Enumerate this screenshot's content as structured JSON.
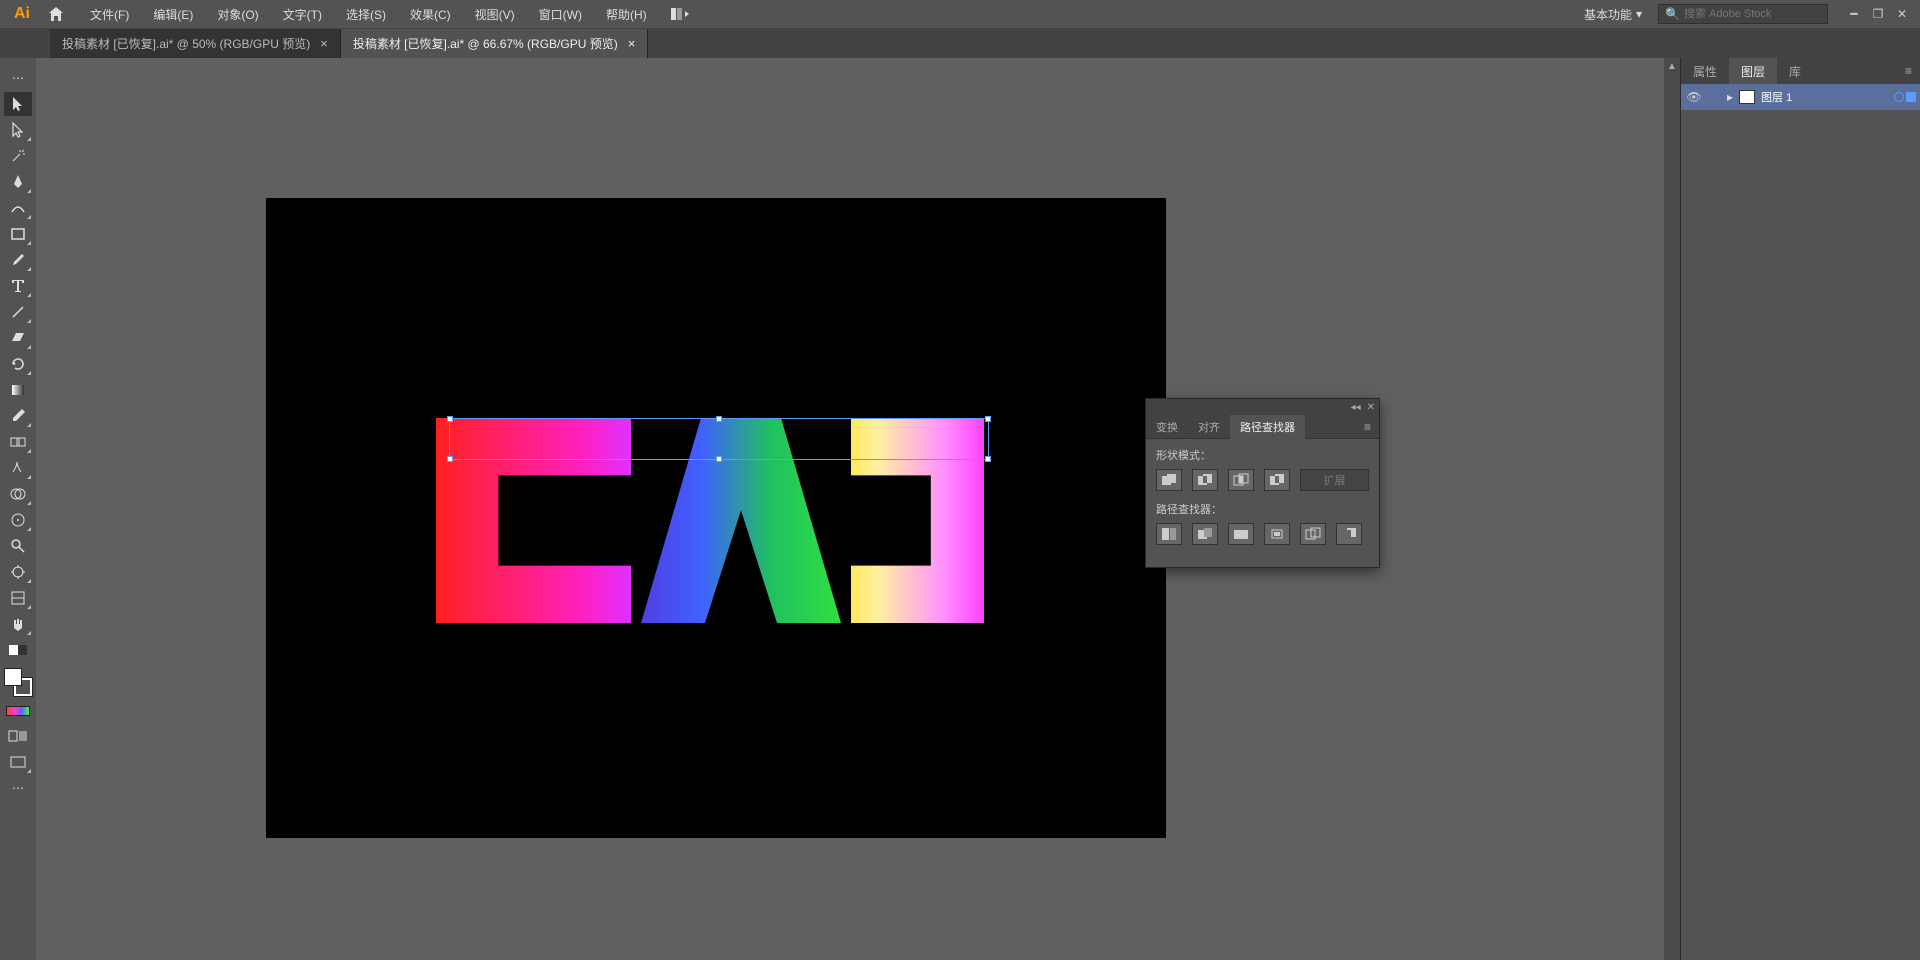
{
  "menubar": {
    "items": [
      "文件(F)",
      "编辑(E)",
      "对象(O)",
      "文字(T)",
      "选择(S)",
      "效果(C)",
      "视图(V)",
      "窗口(W)",
      "帮助(H)"
    ],
    "workspace": "基本功能",
    "search_placeholder": "搜索 Adobe Stock"
  },
  "tabs": [
    {
      "label": "投稿素材 [已恢复].ai* @ 50% (RGB/GPU 预览)",
      "active": false
    },
    {
      "label": "投稿素材 [已恢复].ai* @ 66.67% (RGB/GPU 预览)",
      "active": true
    }
  ],
  "right_panel": {
    "tabs": [
      "属性",
      "图层",
      "库"
    ],
    "active_tab": 1,
    "layer_name": "图层 1"
  },
  "pathfinder": {
    "tabs": [
      "变换",
      "对齐",
      "路径查找器"
    ],
    "active_tab": 2,
    "shape_modes_label": "形状模式：",
    "pathfinders_label": "路径查找器：",
    "expand_label": "扩展"
  },
  "tools": [
    "selection",
    "direct-selection",
    "magic-wand",
    "pen",
    "curvature",
    "rectangle",
    "paintbrush",
    "type",
    "line",
    "eraser",
    "rotate",
    "gradient",
    "eyedropper",
    "blend",
    "scissors",
    "shape-builder",
    "symbol-sprayer",
    "zoom",
    "artboard",
    "slice",
    "hand"
  ]
}
